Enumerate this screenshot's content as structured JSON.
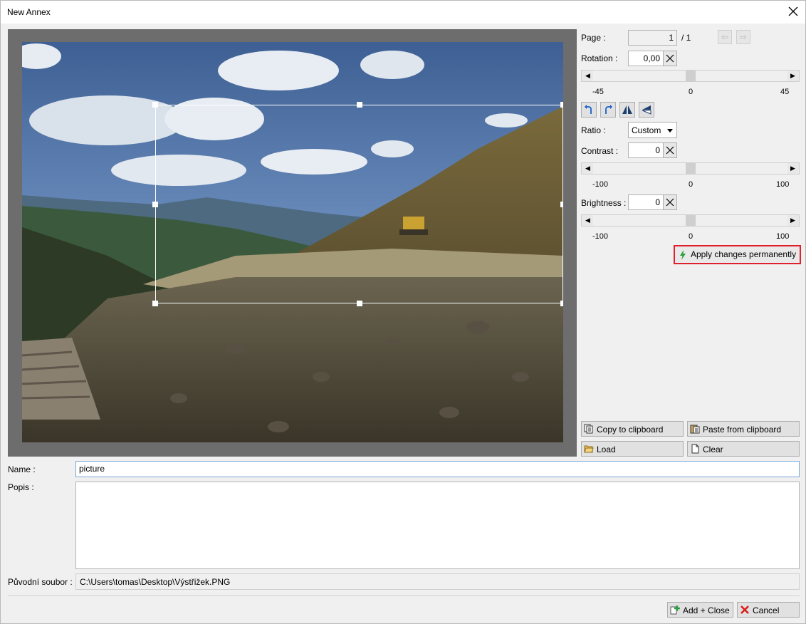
{
  "window": {
    "title": "New Annex"
  },
  "page": {
    "label": "Page :",
    "current": "1",
    "total": "/ 1"
  },
  "rotation": {
    "label": "Rotation :",
    "value": "0,00",
    "min": "-45",
    "mid": "0",
    "max": "45"
  },
  "ratio": {
    "label": "Ratio :",
    "selected": "Custom"
  },
  "contrast": {
    "label": "Contrast :",
    "value": "0",
    "min": "-100",
    "mid": "0",
    "max": "100"
  },
  "brightness": {
    "label": "Brightness :",
    "value": "0",
    "min": "-100",
    "mid": "0",
    "max": "100"
  },
  "apply_label": "Apply changes permanently",
  "clipboard": {
    "copy": "Copy to clipboard",
    "paste": "Paste from clipboard",
    "load": "Load",
    "clear": "Clear"
  },
  "form": {
    "name_label": "Name :",
    "name_value": "picture",
    "popis_label": "Popis :",
    "popis_value": "",
    "source_label": "Původní soubor :",
    "source_value": "C:\\Users\\tomas\\Desktop\\Výstřižek.PNG"
  },
  "footer": {
    "add_close": "Add + Close",
    "cancel": "Cancel"
  },
  "colors": {
    "highlight": "#e0202d",
    "focus_border": "#7aa7d8",
    "add_icon": "#2ea043",
    "cancel_icon": "#d81e1e"
  }
}
